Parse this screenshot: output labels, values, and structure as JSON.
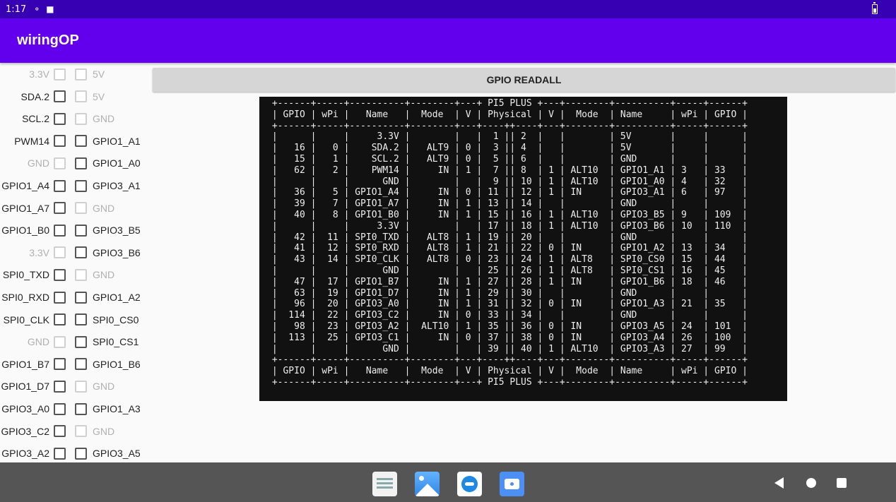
{
  "status_bar": {
    "time": "1:17"
  },
  "app_bar": {
    "title": "wiringOP"
  },
  "button": {
    "label": "GPIO READALL"
  },
  "pins": [
    {
      "left": "3.3V",
      "left_enabled": false,
      "right": "5V",
      "right_enabled": false
    },
    {
      "left": "SDA.2",
      "left_enabled": true,
      "right": "5V",
      "right_enabled": false
    },
    {
      "left": "SCL.2",
      "left_enabled": true,
      "right": "GND",
      "right_enabled": false
    },
    {
      "left": "PWM14",
      "left_enabled": true,
      "right": "GPIO1_A1",
      "right_enabled": true
    },
    {
      "left": "GND",
      "left_enabled": false,
      "right": "GPIO1_A0",
      "right_enabled": true
    },
    {
      "left": "GPIO1_A4",
      "left_enabled": true,
      "right": "GPIO3_A1",
      "right_enabled": true
    },
    {
      "left": "GPIO1_A7",
      "left_enabled": true,
      "right": "GND",
      "right_enabled": false
    },
    {
      "left": "GPIO1_B0",
      "left_enabled": true,
      "right": "GPIO3_B5",
      "right_enabled": true
    },
    {
      "left": "3.3V",
      "left_enabled": false,
      "right": "GPIO3_B6",
      "right_enabled": true
    },
    {
      "left": "SPI0_TXD",
      "left_enabled": true,
      "right": "GND",
      "right_enabled": false
    },
    {
      "left": "SPI0_RXD",
      "left_enabled": true,
      "right": "GPIO1_A2",
      "right_enabled": true
    },
    {
      "left": "SPI0_CLK",
      "left_enabled": true,
      "right": "SPI0_CS0",
      "right_enabled": true
    },
    {
      "left": "GND",
      "left_enabled": false,
      "right": "SPI0_CS1",
      "right_enabled": true
    },
    {
      "left": "GPIO1_B7",
      "left_enabled": true,
      "right": "GPIO1_B6",
      "right_enabled": true
    },
    {
      "left": "GPIO1_D7",
      "left_enabled": true,
      "right": "GND",
      "right_enabled": false
    },
    {
      "left": "GPIO3_A0",
      "left_enabled": true,
      "right": "GPIO1_A3",
      "right_enabled": true
    },
    {
      "left": "GPIO3_C2",
      "left_enabled": true,
      "right": "GND",
      "right_enabled": false
    },
    {
      "left": "GPIO3_A2",
      "left_enabled": true,
      "right": "GPIO3_A5",
      "right_enabled": true
    }
  ],
  "terminal": {
    "lines": [
      " +------+-----+----------+--------+---+ PI5 PLUS +---+--------+----------+-----+------+",
      " | GPIO | wPi |   Name   |  Mode  | V | Physical | V |  Mode  | Name     | wPi | GPIO |",
      " +------+-----+----------+--------+---+----++----+---+--------+----------+-----+------+",
      " |      |     |     3.3V |        |   |  1 || 2  |   |        | 5V       |     |      |",
      " |   16 |   0 |    SDA.2 |   ALT9 | 0 |  3 || 4  |   |        | 5V       |     |      |",
      " |   15 |   1 |    SCL.2 |   ALT9 | 0 |  5 || 6  |   |        | GND      |     |      |",
      " |   62 |   2 |    PWM14 |     IN | 1 |  7 || 8  | 1 | ALT10  | GPIO1_A1 | 3   | 33   |",
      " |      |     |      GND |        |   |  9 || 10 | 1 | ALT10  | GPIO1_A0 | 4   | 32   |",
      " |   36 |   5 | GPIO1_A4 |     IN | 0 | 11 || 12 | 1 | IN     | GPIO3_A1 | 6   | 97   |",
      " |   39 |   7 | GPIO1_A7 |     IN | 1 | 13 || 14 |   |        | GND      |     |      |",
      " |   40 |   8 | GPIO1_B0 |     IN | 1 | 15 || 16 | 1 | ALT10  | GPIO3_B5 | 9   | 109  |",
      " |      |     |     3.3V |        |   | 17 || 18 | 1 | ALT10  | GPIO3_B6 | 10  | 110  |",
      " |   42 |  11 | SPI0_TXD |   ALT8 | 1 | 19 || 20 |   |        | GND      |     |      |",
      " |   41 |  12 | SPI0_RXD |   ALT8 | 1 | 21 || 22 | 0 | IN     | GPIO1_A2 | 13  | 34   |",
      " |   43 |  14 | SPI0_CLK |   ALT8 | 0 | 23 || 24 | 1 | ALT8   | SPI0_CS0 | 15  | 44   |",
      " |      |     |      GND |        |   | 25 || 26 | 1 | ALT8   | SPI0_CS1 | 16  | 45   |",
      " |   47 |  17 | GPIO1_B7 |     IN | 1 | 27 || 28 | 1 | IN     | GPIO1_B6 | 18  | 46   |",
      " |   63 |  19 | GPIO1_D7 |     IN | 1 | 29 || 30 |   |        | GND      |     |      |",
      " |   96 |  20 | GPIO3_A0 |     IN | 1 | 31 || 32 | 0 | IN     | GPIO1_A3 | 21  | 35   |",
      " |  114 |  22 | GPIO3_C2 |     IN | 0 | 33 || 34 |   |        | GND      |     |      |",
      " |   98 |  23 | GPIO3_A2 |  ALT10 | 1 | 35 || 36 | 0 | IN     | GPIO3_A5 | 24  | 101  |",
      " |  113 |  25 | GPIO3_C1 |     IN | 0 | 37 || 38 | 0 | IN     | GPIO3_A4 | 26  | 100  |",
      " |      |     |      GND |        |   | 39 || 40 | 1 | ALT10  | GPIO3_A3 | 27  | 99   |",
      " +------+-----+----------+--------+---+----++----+---+--------+----------+-----+------+",
      " | GPIO | wPi |   Name   |  Mode  | V | Physical | V |  Mode  | Name     | wPi | GPIO |",
      " +------+-----+----------+--------+---+ PI5 PLUS +---+--------+----------+-----+------+"
    ]
  },
  "icons": {
    "status": [
      "sim-icon",
      "sd-card-icon",
      "battery-icon"
    ],
    "dock": [
      "table-app-icon",
      "gallery-app-icon",
      "browser-app-icon",
      "camera-app-icon"
    ],
    "nav": [
      "back-icon",
      "home-icon",
      "recents-icon"
    ]
  },
  "colors": {
    "status_bar": "#3700b3",
    "app_bar": "#6200ee",
    "nav_bar": "#555555",
    "terminal_bg": "#111111"
  }
}
